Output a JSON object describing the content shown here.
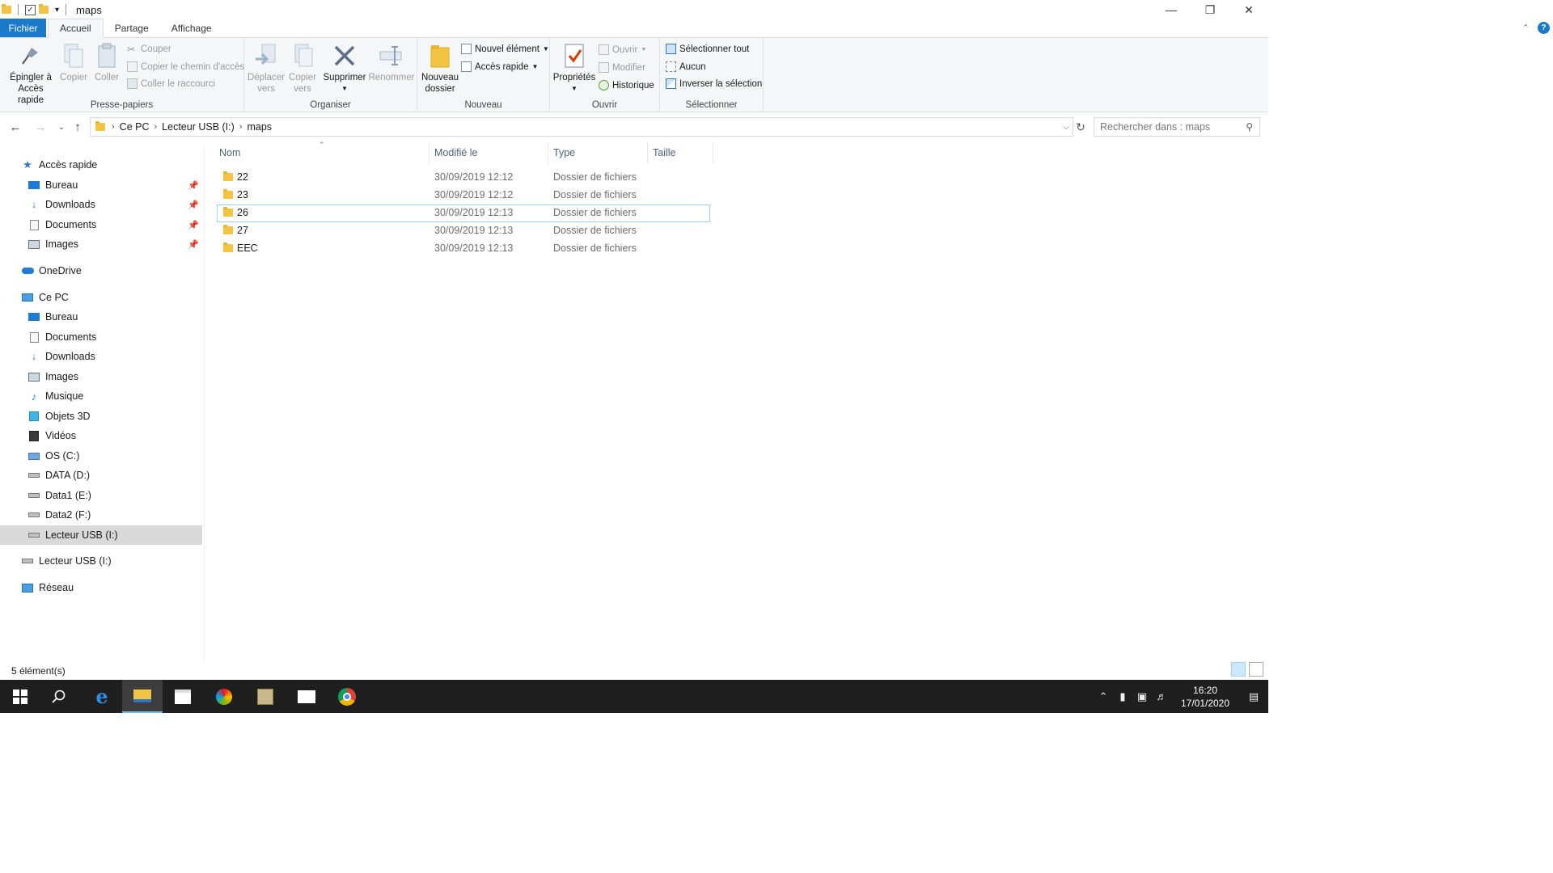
{
  "window": {
    "title": "maps",
    "qa_dropdown": "▾"
  },
  "tabs": {
    "file": "Fichier",
    "home": "Accueil",
    "share": "Partage",
    "view": "Affichage"
  },
  "ribbon": {
    "clipboard": {
      "label": "Presse-papiers",
      "pin_line1": "Épingler à",
      "pin_line2": "Accès rapide",
      "copy": "Copier",
      "paste": "Coller",
      "cut": "Couper",
      "copy_path": "Copier le chemin d'accès",
      "paste_shortcut": "Coller le raccourci"
    },
    "organize": {
      "label": "Organiser",
      "move_line1": "Déplacer",
      "move_line2": "vers",
      "copyto_line1": "Copier",
      "copyto_line2": "vers",
      "delete": "Supprimer",
      "rename": "Renommer"
    },
    "new": {
      "label": "Nouveau",
      "new_folder_line1": "Nouveau",
      "new_folder_line2": "dossier",
      "new_item": "Nouvel élément",
      "easy_access": "Accès rapide"
    },
    "open": {
      "label": "Ouvrir",
      "properties": "Propriétés",
      "open": "Ouvrir",
      "edit": "Modifier",
      "history": "Historique"
    },
    "select": {
      "label": "Sélectionner",
      "select_all": "Sélectionner tout",
      "select_none": "Aucun",
      "invert": "Inverser la sélection"
    }
  },
  "address": {
    "crumbs": [
      "Ce PC",
      "Lecteur USB (I:)",
      "maps"
    ],
    "search_placeholder": "Rechercher dans : maps"
  },
  "sidebar": {
    "quick_access": "Accès rapide",
    "quick_items": [
      "Bureau",
      "Downloads",
      "Documents",
      "Images"
    ],
    "onedrive": "OneDrive",
    "this_pc": "Ce PC",
    "pc_items": [
      "Bureau",
      "Documents",
      "Downloads",
      "Images",
      "Musique",
      "Objets 3D",
      "Vidéos",
      "OS (C:)",
      "DATA (D:)",
      "Data1 (E:)",
      "Data2 (F:)",
      "Lecteur USB (I:)"
    ],
    "usb": "Lecteur USB (I:)",
    "network": "Réseau"
  },
  "list": {
    "headers": {
      "name": "Nom",
      "modified": "Modifié le",
      "type": "Type",
      "size": "Taille"
    },
    "rows": [
      {
        "name": "22",
        "modified": "30/09/2019 12:12",
        "type": "Dossier de fichiers"
      },
      {
        "name": "23",
        "modified": "30/09/2019 12:12",
        "type": "Dossier de fichiers"
      },
      {
        "name": "26",
        "modified": "30/09/2019 12:13",
        "type": "Dossier de fichiers"
      },
      {
        "name": "27",
        "modified": "30/09/2019 12:13",
        "type": "Dossier de fichiers"
      },
      {
        "name": "EEC",
        "modified": "30/09/2019 12:13",
        "type": "Dossier de fichiers"
      }
    ]
  },
  "status": {
    "count": "5 élément(s)"
  },
  "taskbar": {
    "time": "16:20",
    "date": "17/01/2020"
  },
  "colors": {
    "accent": "#1979ca",
    "selection": "#d9d9d9",
    "focus": "#99d1ff",
    "folder": "#f3c443"
  }
}
